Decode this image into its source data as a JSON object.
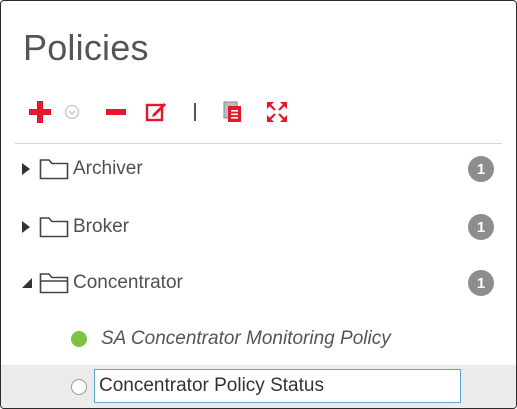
{
  "panel": {
    "title": "Policies"
  },
  "toolbar": {
    "add_icon": "plus-icon",
    "caret_icon": "chevron-down-circle-icon",
    "remove_icon": "minus-icon",
    "edit_icon": "edit-icon",
    "duplicate_icon": "duplicate-icon",
    "expand_icon": "expand-icon"
  },
  "tree": {
    "groups": [
      {
        "label": "Archiver",
        "count": "1",
        "expanded": false
      },
      {
        "label": "Broker",
        "count": "1",
        "expanded": false
      },
      {
        "label": "Concentrator",
        "count": "1",
        "expanded": true
      }
    ],
    "concentrator_policies": [
      {
        "label": "SA Concentrator Monitoring Policy",
        "status": "active"
      }
    ],
    "new_policy": {
      "value": "Concentrator Policy Status",
      "status": "inactive"
    }
  },
  "colors": {
    "accent_red": "#e3192b",
    "active_green": "#7fc241",
    "badge_gray": "#8d8d8d",
    "input_border": "#5aa9d6"
  }
}
